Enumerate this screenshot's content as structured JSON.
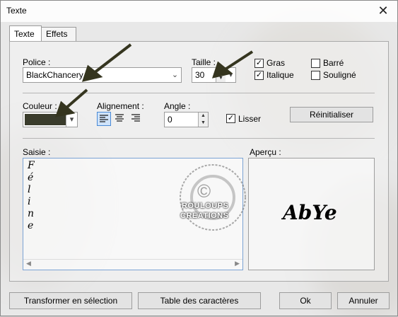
{
  "window": {
    "title": "Texte",
    "close_glyph": "✕"
  },
  "tabs": [
    {
      "label": "Texte",
      "active": true
    },
    {
      "label": "Effets",
      "active": false
    }
  ],
  "font": {
    "label": "Police :",
    "value": "BlackChancery"
  },
  "size": {
    "label": "Taille :",
    "value": "30"
  },
  "options": {
    "bold": {
      "label": "Gras",
      "checked": true
    },
    "italic": {
      "label": "Italique",
      "checked": true
    },
    "strike": {
      "label": "Barré",
      "checked": false
    },
    "underline": {
      "label": "Souligné",
      "checked": false
    }
  },
  "color": {
    "label": "Couleur :",
    "value": "#3a3c2c"
  },
  "alignment": {
    "label": "Alignement :",
    "selected": "left"
  },
  "angle": {
    "label": "Angle :",
    "value": "0"
  },
  "smooth": {
    "label": "Lisser",
    "checked": true
  },
  "reset_button": "Réinitialiser",
  "input": {
    "label": "Saisie :",
    "letters": [
      "F",
      "é",
      "l",
      "i",
      "n",
      "e"
    ]
  },
  "preview": {
    "label": "Aperçu :",
    "sample": "AbYe"
  },
  "watermark": {
    "line1": "ROULOUPS",
    "line2": "CREATIONS",
    "logo_glyph": "©"
  },
  "footer": {
    "convert_button": "Transformer en sélection",
    "charmap_button": "Table des caractères",
    "ok_button": "Ok",
    "cancel_button": "Annuler"
  },
  "colors": {
    "accent": "#4a8ad6",
    "arrow": "#35351f"
  }
}
